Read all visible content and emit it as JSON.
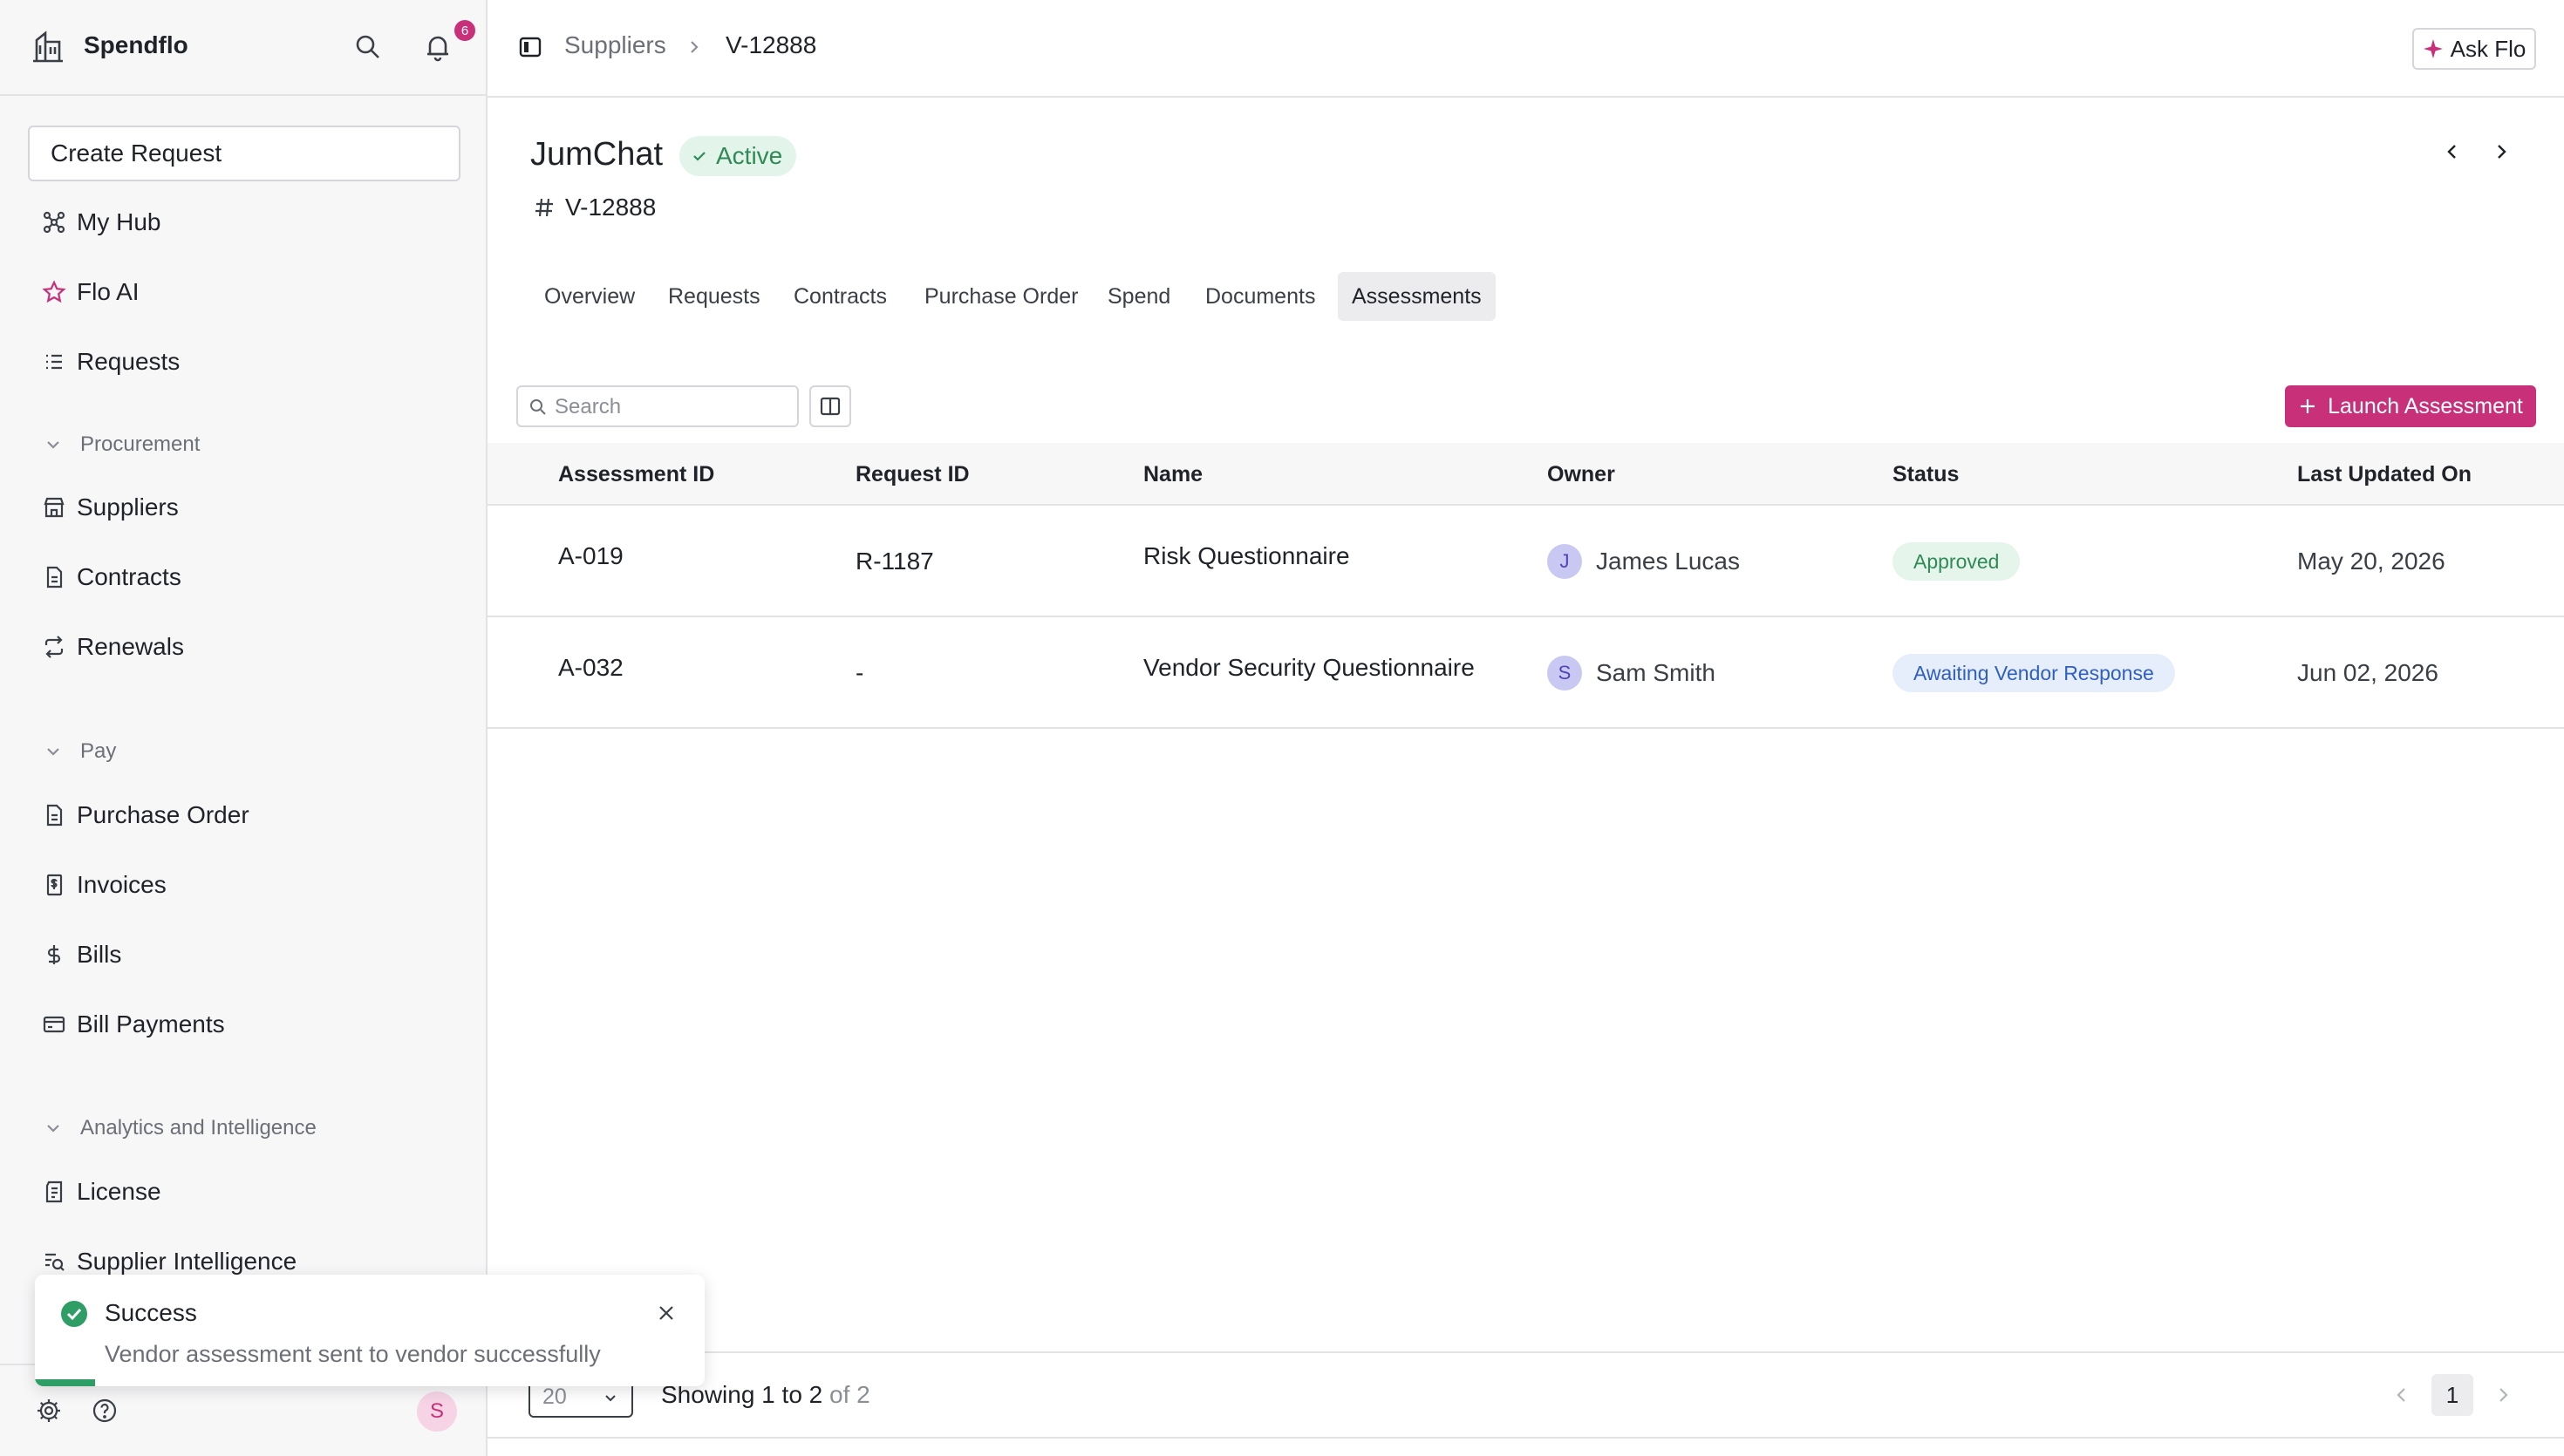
{
  "sidebar": {
    "brand": "Spendflo",
    "notification_count": "6",
    "create_request_label": "Create Request",
    "items_top": [
      {
        "label": "My Hub",
        "icon": "hub-icon"
      },
      {
        "label": "Flo AI",
        "icon": "star-icon"
      },
      {
        "label": "Requests",
        "icon": "list-icon"
      }
    ],
    "procurement": {
      "title": "Procurement",
      "items": [
        {
          "label": "Suppliers",
          "icon": "store-icon"
        },
        {
          "label": "Contracts",
          "icon": "document-icon"
        },
        {
          "label": "Renewals",
          "icon": "refresh-icon"
        }
      ]
    },
    "pay": {
      "title": "Pay",
      "items": [
        {
          "label": "Purchase Order",
          "icon": "document-icon"
        },
        {
          "label": "Invoices",
          "icon": "invoice-icon"
        },
        {
          "label": "Bills",
          "icon": "dollar-icon"
        },
        {
          "label": "Bill Payments",
          "icon": "card-icon"
        }
      ]
    },
    "analytics": {
      "title": "Analytics and Intelligence",
      "items": [
        {
          "label": "License",
          "icon": "license-icon"
        },
        {
          "label": "Supplier Intelligence",
          "icon": "search-list-icon"
        }
      ]
    },
    "user_initial": "S"
  },
  "toast": {
    "title": "Success",
    "message": "Vendor assessment sent to vendor successfully",
    "progress": 0.09
  },
  "topbar": {
    "breadcrumb": [
      "Suppliers",
      "V-12888"
    ],
    "ask_flo_label": "Ask Flo"
  },
  "vendor": {
    "name": "JumChat",
    "status": "Active",
    "id": "V-12888"
  },
  "tabs": [
    "Overview",
    "Requests",
    "Contracts",
    "Purchase Order",
    "Spend",
    "Documents",
    "Assessments"
  ],
  "active_tab": "Assessments",
  "toolbar": {
    "search_placeholder": "Search",
    "launch_label": "Launch Assessment"
  },
  "table": {
    "columns": [
      "Assessment ID",
      "Request ID",
      "Name",
      "Owner",
      "Status",
      "Last Updated On"
    ],
    "rows": [
      {
        "assessment_id": "A-019",
        "request_id": "R-1187",
        "name": "Risk Questionnaire",
        "owner_initial": "J",
        "owner": "James Lucas",
        "status": "Approved",
        "updated": "May 20, 2026"
      },
      {
        "assessment_id": "A-032",
        "request_id": "-",
        "name": "Vendor Security Questionnaire",
        "owner_initial": "S",
        "owner": "Sam Smith",
        "status": "Awaiting Vendor Response",
        "updated": "Jun 02, 2026"
      }
    ]
  },
  "pagination": {
    "page_size": "20",
    "showing": "Showing 1 to 2",
    "of_total": "of 2",
    "current_page": "1"
  },
  "colors": {
    "accent": "#c8317a",
    "success": "#2e9e66",
    "approved_bg": "#e6f5ec",
    "awaiting_bg": "#e6eefc"
  }
}
